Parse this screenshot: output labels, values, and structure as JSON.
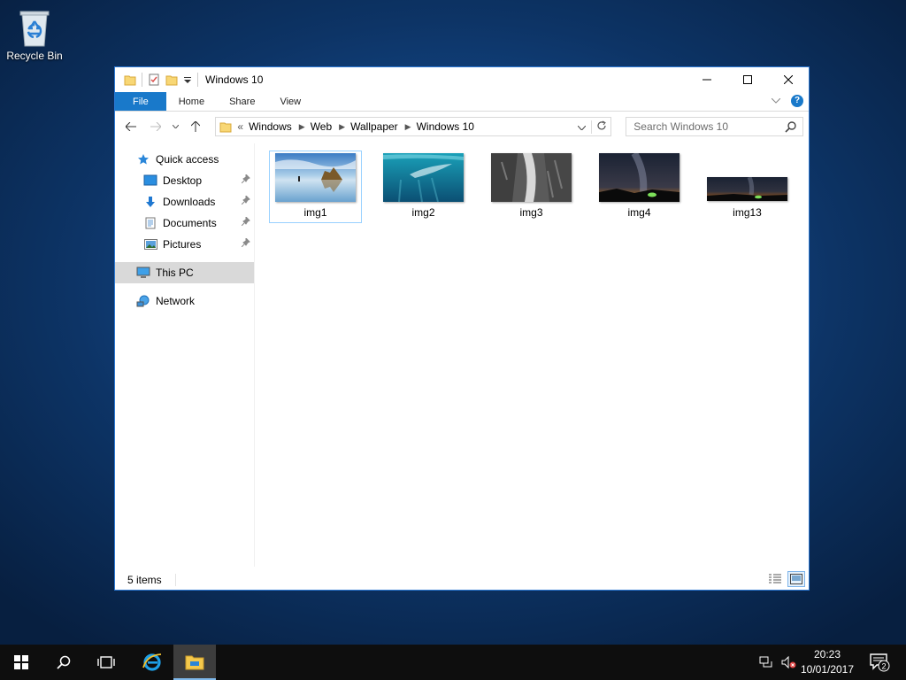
{
  "desktop": {
    "recycle_bin_label": "Recycle Bin"
  },
  "window": {
    "title": "Windows 10",
    "ribbon_tabs": [
      "File",
      "Home",
      "Share",
      "View"
    ],
    "address": {
      "prefix": "«",
      "crumbs": [
        "Windows",
        "Web",
        "Wallpaper",
        "Windows 10"
      ]
    },
    "search_placeholder": "Search Windows 10",
    "nav": {
      "quick_access": "Quick access",
      "pinned": [
        "Desktop",
        "Downloads",
        "Documents",
        "Pictures"
      ],
      "this_pc": "This PC",
      "network": "Network"
    },
    "files": [
      {
        "name": "img1"
      },
      {
        "name": "img2"
      },
      {
        "name": "img3"
      },
      {
        "name": "img4"
      },
      {
        "name": "img13"
      }
    ],
    "status_count": "5 items"
  },
  "taskbar": {
    "time": "20:23",
    "date": "10/01/2017",
    "notification_count": "2"
  },
  "colors": {
    "accent": "#1979ca",
    "selection": "#99d1ff",
    "taskbar": "#0e0e0e"
  }
}
